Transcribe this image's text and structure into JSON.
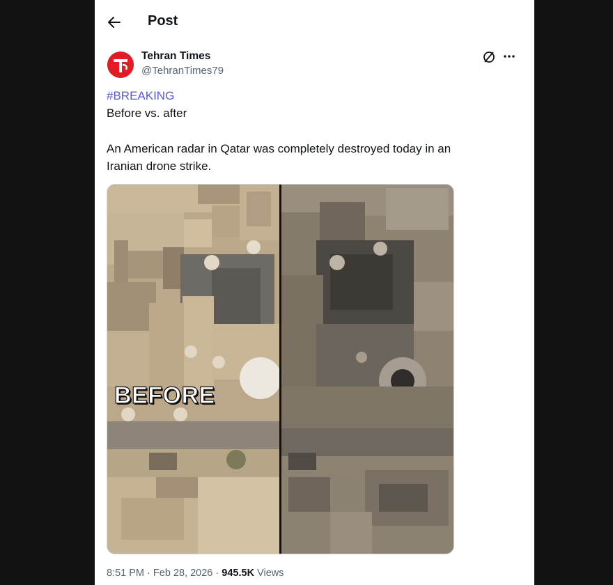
{
  "header": {
    "title": "Post"
  },
  "post": {
    "author_name": "Tehran Times",
    "author_handle": "@TehranTimes79",
    "hashtag": "#BREAKING",
    "line1": "Before vs. after",
    "line2": "An American radar in Qatar was completely destroyed today in an",
    "line3": "Iranian drone strike.",
    "image_label": "BEFORE",
    "time": "8:51 PM",
    "separator1": "·",
    "date": "Feb 28, 2026",
    "separator2": "·",
    "views_count": "945.5K",
    "views_label": "Views"
  },
  "icons": {
    "back": "arrow-left-icon",
    "grok": "grok-icon",
    "more": "more-horizontal-icon",
    "avatar": "tehran-times-logo"
  },
  "colors": {
    "hashtag": "#5b5bd6",
    "avatar": "#e31b23",
    "secondary_text": "#536471"
  }
}
